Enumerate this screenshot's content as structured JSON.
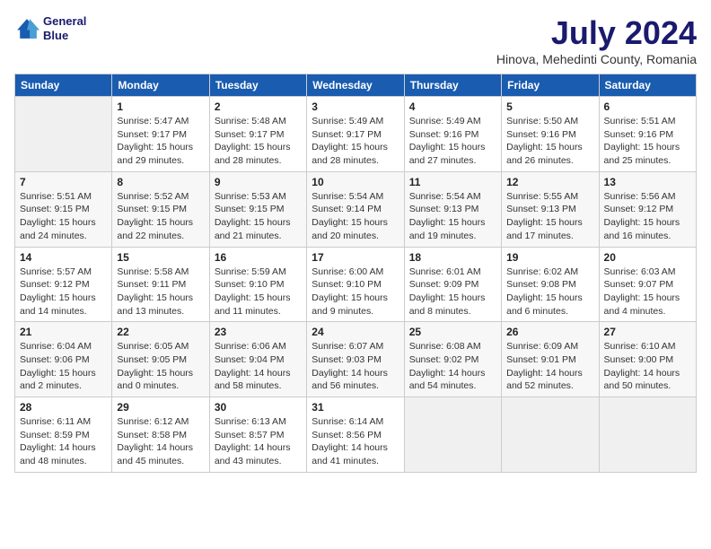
{
  "logo": {
    "line1": "General",
    "line2": "Blue"
  },
  "title": "July 2024",
  "location": "Hinova, Mehedinti County, Romania",
  "days_of_week": [
    "Sunday",
    "Monday",
    "Tuesday",
    "Wednesday",
    "Thursday",
    "Friday",
    "Saturday"
  ],
  "weeks": [
    [
      {
        "day": "",
        "sunrise": "",
        "sunset": "",
        "daylight": ""
      },
      {
        "day": "1",
        "sunrise": "Sunrise: 5:47 AM",
        "sunset": "Sunset: 9:17 PM",
        "daylight": "Daylight: 15 hours and 29 minutes."
      },
      {
        "day": "2",
        "sunrise": "Sunrise: 5:48 AM",
        "sunset": "Sunset: 9:17 PM",
        "daylight": "Daylight: 15 hours and 28 minutes."
      },
      {
        "day": "3",
        "sunrise": "Sunrise: 5:49 AM",
        "sunset": "Sunset: 9:17 PM",
        "daylight": "Daylight: 15 hours and 28 minutes."
      },
      {
        "day": "4",
        "sunrise": "Sunrise: 5:49 AM",
        "sunset": "Sunset: 9:16 PM",
        "daylight": "Daylight: 15 hours and 27 minutes."
      },
      {
        "day": "5",
        "sunrise": "Sunrise: 5:50 AM",
        "sunset": "Sunset: 9:16 PM",
        "daylight": "Daylight: 15 hours and 26 minutes."
      },
      {
        "day": "6",
        "sunrise": "Sunrise: 5:51 AM",
        "sunset": "Sunset: 9:16 PM",
        "daylight": "Daylight: 15 hours and 25 minutes."
      }
    ],
    [
      {
        "day": "7",
        "sunrise": "Sunrise: 5:51 AM",
        "sunset": "Sunset: 9:15 PM",
        "daylight": "Daylight: 15 hours and 24 minutes."
      },
      {
        "day": "8",
        "sunrise": "Sunrise: 5:52 AM",
        "sunset": "Sunset: 9:15 PM",
        "daylight": "Daylight: 15 hours and 22 minutes."
      },
      {
        "day": "9",
        "sunrise": "Sunrise: 5:53 AM",
        "sunset": "Sunset: 9:15 PM",
        "daylight": "Daylight: 15 hours and 21 minutes."
      },
      {
        "day": "10",
        "sunrise": "Sunrise: 5:54 AM",
        "sunset": "Sunset: 9:14 PM",
        "daylight": "Daylight: 15 hours and 20 minutes."
      },
      {
        "day": "11",
        "sunrise": "Sunrise: 5:54 AM",
        "sunset": "Sunset: 9:13 PM",
        "daylight": "Daylight: 15 hours and 19 minutes."
      },
      {
        "day": "12",
        "sunrise": "Sunrise: 5:55 AM",
        "sunset": "Sunset: 9:13 PM",
        "daylight": "Daylight: 15 hours and 17 minutes."
      },
      {
        "day": "13",
        "sunrise": "Sunrise: 5:56 AM",
        "sunset": "Sunset: 9:12 PM",
        "daylight": "Daylight: 15 hours and 16 minutes."
      }
    ],
    [
      {
        "day": "14",
        "sunrise": "Sunrise: 5:57 AM",
        "sunset": "Sunset: 9:12 PM",
        "daylight": "Daylight: 15 hours and 14 minutes."
      },
      {
        "day": "15",
        "sunrise": "Sunrise: 5:58 AM",
        "sunset": "Sunset: 9:11 PM",
        "daylight": "Daylight: 15 hours and 13 minutes."
      },
      {
        "day": "16",
        "sunrise": "Sunrise: 5:59 AM",
        "sunset": "Sunset: 9:10 PM",
        "daylight": "Daylight: 15 hours and 11 minutes."
      },
      {
        "day": "17",
        "sunrise": "Sunrise: 6:00 AM",
        "sunset": "Sunset: 9:10 PM",
        "daylight": "Daylight: 15 hours and 9 minutes."
      },
      {
        "day": "18",
        "sunrise": "Sunrise: 6:01 AM",
        "sunset": "Sunset: 9:09 PM",
        "daylight": "Daylight: 15 hours and 8 minutes."
      },
      {
        "day": "19",
        "sunrise": "Sunrise: 6:02 AM",
        "sunset": "Sunset: 9:08 PM",
        "daylight": "Daylight: 15 hours and 6 minutes."
      },
      {
        "day": "20",
        "sunrise": "Sunrise: 6:03 AM",
        "sunset": "Sunset: 9:07 PM",
        "daylight": "Daylight: 15 hours and 4 minutes."
      }
    ],
    [
      {
        "day": "21",
        "sunrise": "Sunrise: 6:04 AM",
        "sunset": "Sunset: 9:06 PM",
        "daylight": "Daylight: 15 hours and 2 minutes."
      },
      {
        "day": "22",
        "sunrise": "Sunrise: 6:05 AM",
        "sunset": "Sunset: 9:05 PM",
        "daylight": "Daylight: 15 hours and 0 minutes."
      },
      {
        "day": "23",
        "sunrise": "Sunrise: 6:06 AM",
        "sunset": "Sunset: 9:04 PM",
        "daylight": "Daylight: 14 hours and 58 minutes."
      },
      {
        "day": "24",
        "sunrise": "Sunrise: 6:07 AM",
        "sunset": "Sunset: 9:03 PM",
        "daylight": "Daylight: 14 hours and 56 minutes."
      },
      {
        "day": "25",
        "sunrise": "Sunrise: 6:08 AM",
        "sunset": "Sunset: 9:02 PM",
        "daylight": "Daylight: 14 hours and 54 minutes."
      },
      {
        "day": "26",
        "sunrise": "Sunrise: 6:09 AM",
        "sunset": "Sunset: 9:01 PM",
        "daylight": "Daylight: 14 hours and 52 minutes."
      },
      {
        "day": "27",
        "sunrise": "Sunrise: 6:10 AM",
        "sunset": "Sunset: 9:00 PM",
        "daylight": "Daylight: 14 hours and 50 minutes."
      }
    ],
    [
      {
        "day": "28",
        "sunrise": "Sunrise: 6:11 AM",
        "sunset": "Sunset: 8:59 PM",
        "daylight": "Daylight: 14 hours and 48 minutes."
      },
      {
        "day": "29",
        "sunrise": "Sunrise: 6:12 AM",
        "sunset": "Sunset: 8:58 PM",
        "daylight": "Daylight: 14 hours and 45 minutes."
      },
      {
        "day": "30",
        "sunrise": "Sunrise: 6:13 AM",
        "sunset": "Sunset: 8:57 PM",
        "daylight": "Daylight: 14 hours and 43 minutes."
      },
      {
        "day": "31",
        "sunrise": "Sunrise: 6:14 AM",
        "sunset": "Sunset: 8:56 PM",
        "daylight": "Daylight: 14 hours and 41 minutes."
      },
      {
        "day": "",
        "sunrise": "",
        "sunset": "",
        "daylight": ""
      },
      {
        "day": "",
        "sunrise": "",
        "sunset": "",
        "daylight": ""
      },
      {
        "day": "",
        "sunrise": "",
        "sunset": "",
        "daylight": ""
      }
    ]
  ]
}
